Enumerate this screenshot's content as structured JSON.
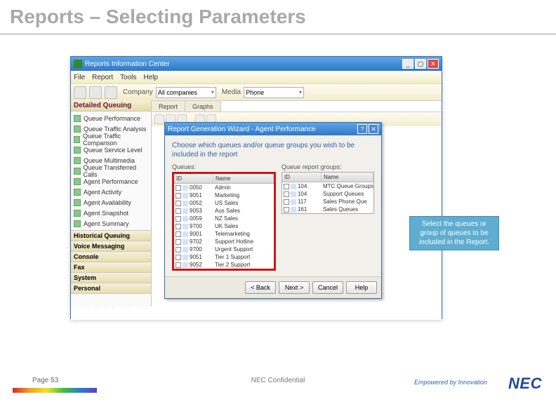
{
  "slide": {
    "title": "Reports – Selecting Parameters"
  },
  "window": {
    "title": "Reports Information Center",
    "menu": [
      "File",
      "Report",
      "Tools",
      "Help"
    ],
    "toolbar": {
      "company_label": "Company",
      "company_value": "All companies",
      "media_label": "Media",
      "media_value": "Phone"
    }
  },
  "sidebar": {
    "section_hdr": "Detailed Queuing",
    "items": [
      "Queue Performance",
      "Queue Traffic Analysis",
      "Queue Traffic Comparison",
      "Queue Service Level",
      "Queue Multimedia",
      "Queue Transferred Calls",
      "Agent Performance",
      "Agent Activity",
      "Agent Availability",
      "Agent Snapshot",
      "Agent Summary"
    ],
    "categories": [
      "Historical Queuing",
      "Voice Messaging",
      "Console",
      "Fax",
      "System",
      "Personal"
    ]
  },
  "content": {
    "tabs": [
      "Report",
      "Graphs"
    ]
  },
  "dialog": {
    "title": "Report Generation Wizard - Agent Performance",
    "instruction": "Choose which queues and/or queue groups you wish to be included in the report",
    "queues_label": "Queues:",
    "groups_label": "Queue report groups:",
    "col_id": "ID",
    "col_name": "Name",
    "queues": [
      {
        "id": "0050",
        "name": "Admin"
      },
      {
        "id": "9051",
        "name": "Marketing"
      },
      {
        "id": "0052",
        "name": "US Sales"
      },
      {
        "id": "9053",
        "name": "Aus Sales"
      },
      {
        "id": "0059",
        "name": "NZ Sales"
      },
      {
        "id": "9700",
        "name": "UK Sales"
      },
      {
        "id": "9001",
        "name": "Telemarketing"
      },
      {
        "id": "9702",
        "name": "Support Hotline"
      },
      {
        "id": "9700",
        "name": "Urgent Support"
      },
      {
        "id": "9051",
        "name": "Tier 1 Support"
      },
      {
        "id": "9052",
        "name": "Tier 2 Support"
      }
    ],
    "groups": [
      {
        "id": "104",
        "name": "MTC Queue Groups"
      },
      {
        "id": "104",
        "name": "Support Queues"
      },
      {
        "id": "117",
        "name": "Sales Phone Que"
      },
      {
        "id": "161",
        "name": "Sales Queues"
      }
    ],
    "buttons": {
      "back": "< Back",
      "next": "Next >",
      "cancel": "Cancel",
      "help": "Help"
    }
  },
  "callout": {
    "text": "Select the queues or group of queues to be included in the Report."
  },
  "footer": {
    "page": "Page 53",
    "confidential": "NEC Confidential",
    "tagline": "Empowered by Innovation",
    "brand": "NEC"
  }
}
